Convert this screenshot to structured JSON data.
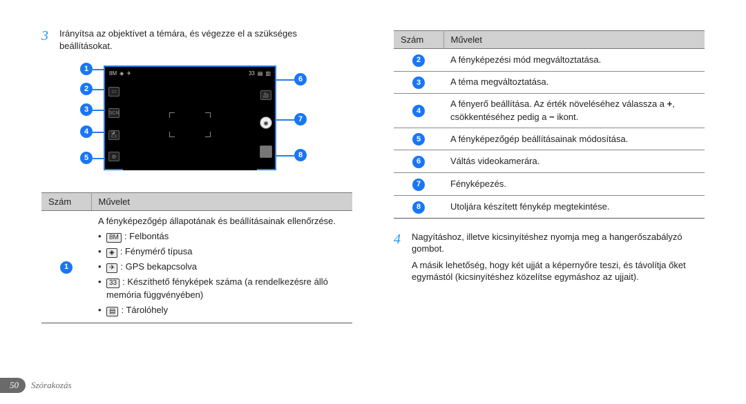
{
  "page": {
    "number": "50",
    "section": "Szórakozás"
  },
  "steps": {
    "s3": {
      "num": "3",
      "text": "Irányítsa az objektívet a témára, és végezze el a szükséges beállításokat."
    },
    "s4": {
      "num": "4",
      "text": "Nagyításhoz, illetve kicsinyítéshez nyomja meg a hangerőszabályzó gombot.",
      "para": "A másik lehetőség, hogy két ujját a képernyőre teszi, és távolítja őket egymástól (kicsinyítéshez közelítse egymáshoz az ujjait)."
    }
  },
  "table_head": {
    "num": "Szám",
    "op": "Művelet"
  },
  "row1": {
    "num": "1",
    "line1": "A fényképezőgép állapotának és beállításainak ellenőrzése.",
    "b1": ": Felbontás",
    "b2": ": Fénymérő típusa",
    "b3": ": GPS bekapcsolva",
    "b4": ": Készíthető fényképek száma (a rendelkezésre álló memória függvényében)",
    "b5": ": Tárolóhely",
    "i1": "8M",
    "i4": "33"
  },
  "rows2": [
    {
      "num": "2",
      "text": "A fényképezési mód megváltoztatása."
    },
    {
      "num": "3",
      "text": "A téma megváltoztatása."
    },
    {
      "num": "4",
      "text_a": "A fényerő beállítása. Az érték növeléséhez válassza a ",
      "plus": "+",
      "text_b": ", csökkentéséhez pedig a ",
      "minus": "−",
      "text_c": " ikont."
    },
    {
      "num": "5",
      "text": "A fényképezőgép beállításainak módosítása."
    },
    {
      "num": "6",
      "text": "Váltás videokamerára."
    },
    {
      "num": "7",
      "text": "Fényképezés."
    },
    {
      "num": "8",
      "text": "Utoljára készített fénykép megtekintése."
    }
  ]
}
